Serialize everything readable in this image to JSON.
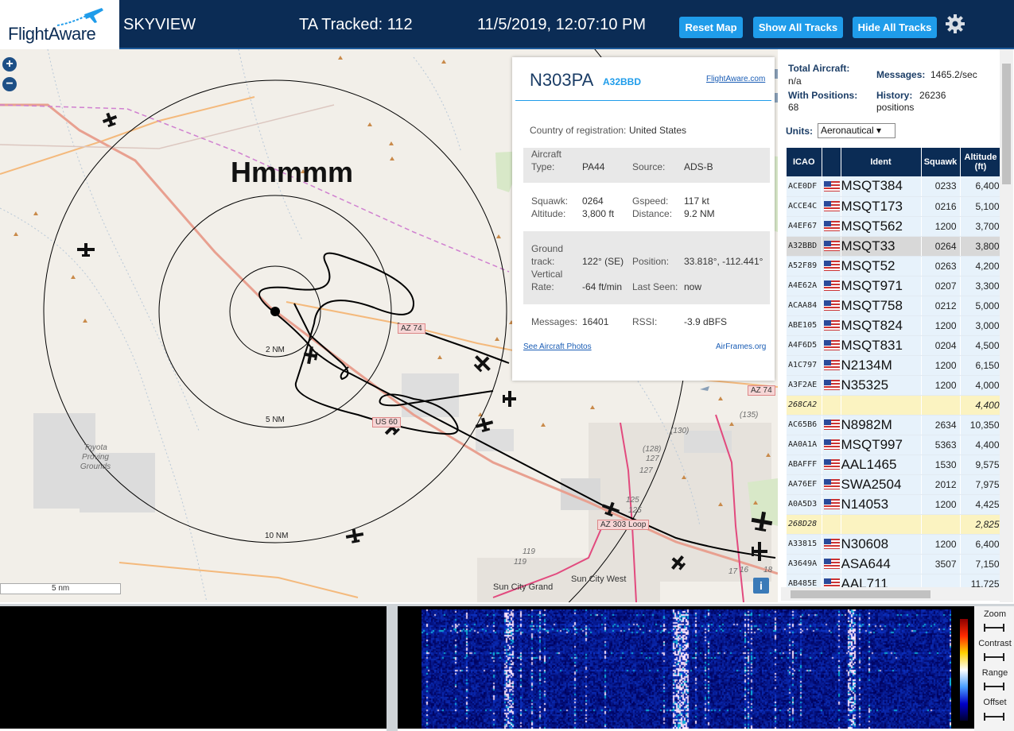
{
  "brand": "FlightAware",
  "topbar": {
    "title": "SKYVIEW",
    "tracked": "TA Tracked: 112",
    "datetime": "11/5/2019, 12:07:10 PM",
    "reset_label": "Reset Map",
    "show_label": "Show All Tracks",
    "hide_label": "Hide All Tracks"
  },
  "map": {
    "zoom_in": "+",
    "zoom_out": "−",
    "overlay_text": "Hmmmm",
    "rings": [
      "2 NM",
      "5 NM",
      "10 NM"
    ],
    "places": {
      "sun_city_grand": "Sun City Grand",
      "sun_city_west": "Sun City West",
      "toyota": "Toyota Proving Grounds"
    },
    "roads": {
      "az74_a": "AZ 74",
      "az74_b": "AZ 74",
      "us60": "US 60",
      "az303": "AZ 303 Loop",
      "r125a": "125",
      "r125b": "125",
      "r127a": "127",
      "r127b": "127",
      "r128": "(128)",
      "r130": "(130)",
      "r135": "(135)",
      "r119a": "119",
      "r119b": "119",
      "r17": "17",
      "r16": "16",
      "r18": "18"
    },
    "scale_label": "5 nm",
    "info": "i"
  },
  "popup": {
    "reg": "N303PA",
    "hex": "A32BBD",
    "fa_link": "FlightAware.com",
    "country_label": "Country of registration:",
    "country": "United States",
    "aircraft_label_1": "Aircraft",
    "aircraft_label_2": "Type:",
    "type": "PA44",
    "source_label": "Source:",
    "source": "ADS-B",
    "squawk_label": "Squawk:",
    "squawk": "0264",
    "altitude_label": "Altitude:",
    "altitude": "3,800 ft",
    "gspeed_label": "Gspeed:",
    "gspeed": "117 kt",
    "distance_label": "Distance:",
    "distance": "9.2 NM",
    "ground_label_1": "Ground",
    "ground_label_2": "track:",
    "track": "122° (SE)",
    "position_label": "Position:",
    "position": "33.818°, -112.441°",
    "vert_label_1": "Vertical",
    "vert_label_2": "Rate:",
    "vrate": "-64 ft/min",
    "lastseen_label": "Last Seen:",
    "lastseen": "now",
    "messages_label": "Messages:",
    "messages": "16401",
    "rssi_label": "RSSI:",
    "rssi": "-3.9 dBFS",
    "photos_link": "See Aircraft Photos",
    "airframes_link": "AirFrames.org"
  },
  "sidebar": {
    "total_label": "Total Aircraft:",
    "total": "n/a",
    "msgs_label": "Messages:",
    "msgs": "1465.2/sec",
    "withpos_label": "With Positions:",
    "withpos": "68",
    "history_label": "History:",
    "history": "26236",
    "history_unit": "positions",
    "units_label": "Units:",
    "units_value": "Aeronautical ▾",
    "headers": {
      "icao": "ICAO",
      "ident": "Ident",
      "squawk": "Squawk",
      "altitude": "Altitude (ft)"
    },
    "rows": [
      {
        "icao": "ACE0DF",
        "flag": true,
        "ident": "MSQT384",
        "squawk": "0233",
        "alt": "6,400"
      },
      {
        "icao": "ACCE4C",
        "flag": true,
        "ident": "MSQT173",
        "squawk": "0216",
        "alt": "5,100"
      },
      {
        "icao": "A4EF67",
        "flag": true,
        "ident": "MSQT562",
        "squawk": "1200",
        "alt": "3,700"
      },
      {
        "icao": "A32BBD",
        "flag": true,
        "ident": "MSQT33",
        "squawk": "0264",
        "alt": "3,800"
      },
      {
        "icao": "A52F89",
        "flag": true,
        "ident": "MSQT52",
        "squawk": "0263",
        "alt": "4,200"
      },
      {
        "icao": "A4E62A",
        "flag": true,
        "ident": "MSQT971",
        "squawk": "0207",
        "alt": "3,300"
      },
      {
        "icao": "ACAA84",
        "flag": true,
        "ident": "MSQT758",
        "squawk": "0212",
        "alt": "5,000"
      },
      {
        "icao": "ABE105",
        "flag": true,
        "ident": "MSQT824",
        "squawk": "1200",
        "alt": "3,000"
      },
      {
        "icao": "A4F6D5",
        "flag": true,
        "ident": "MSQT831",
        "squawk": "0204",
        "alt": "4,500"
      },
      {
        "icao": "A1C797",
        "flag": true,
        "ident": "N2134M",
        "squawk": "1200",
        "alt": "6,150"
      },
      {
        "icao": "A3F2AE",
        "flag": true,
        "ident": "N35325",
        "squawk": "1200",
        "alt": "4,000"
      },
      {
        "icao": "268CA2",
        "flag": false,
        "ident": "",
        "squawk": "",
        "alt": "4,400"
      },
      {
        "icao": "AC65B6",
        "flag": true,
        "ident": "N8982M",
        "squawk": "2634",
        "alt": "10,350"
      },
      {
        "icao": "AA0A1A",
        "flag": true,
        "ident": "MSQT997",
        "squawk": "5363",
        "alt": "4,400"
      },
      {
        "icao": "ABAFFF",
        "flag": true,
        "ident": "AAL1465",
        "squawk": "1530",
        "alt": "9,575"
      },
      {
        "icao": "AA76EF",
        "flag": true,
        "ident": "SWA2504",
        "squawk": "2012",
        "alt": "7,975"
      },
      {
        "icao": "A0A5D3",
        "flag": true,
        "ident": "N14053",
        "squawk": "1200",
        "alt": "4,425"
      },
      {
        "icao": "268D28",
        "flag": false,
        "ident": "",
        "squawk": "",
        "alt": "2,825"
      },
      {
        "icao": "A33815",
        "flag": true,
        "ident": "N30608",
        "squawk": "1200",
        "alt": "6,400"
      },
      {
        "icao": "A3649A",
        "flag": true,
        "ident": "ASA644",
        "squawk": "3507",
        "alt": "7,150"
      },
      {
        "icao": "AB485E",
        "flag": true,
        "ident": "AAL711",
        "squawk": "",
        "alt": "11,725"
      }
    ]
  },
  "spectrum": {
    "zoom": "Zoom",
    "contrast": "Contrast",
    "range": "Range",
    "offset": "Offset"
  },
  "colors": {
    "header_bg": "#0b2c55",
    "button_bg": "#1f9cea",
    "highlight_row": "#fbf3c1"
  }
}
